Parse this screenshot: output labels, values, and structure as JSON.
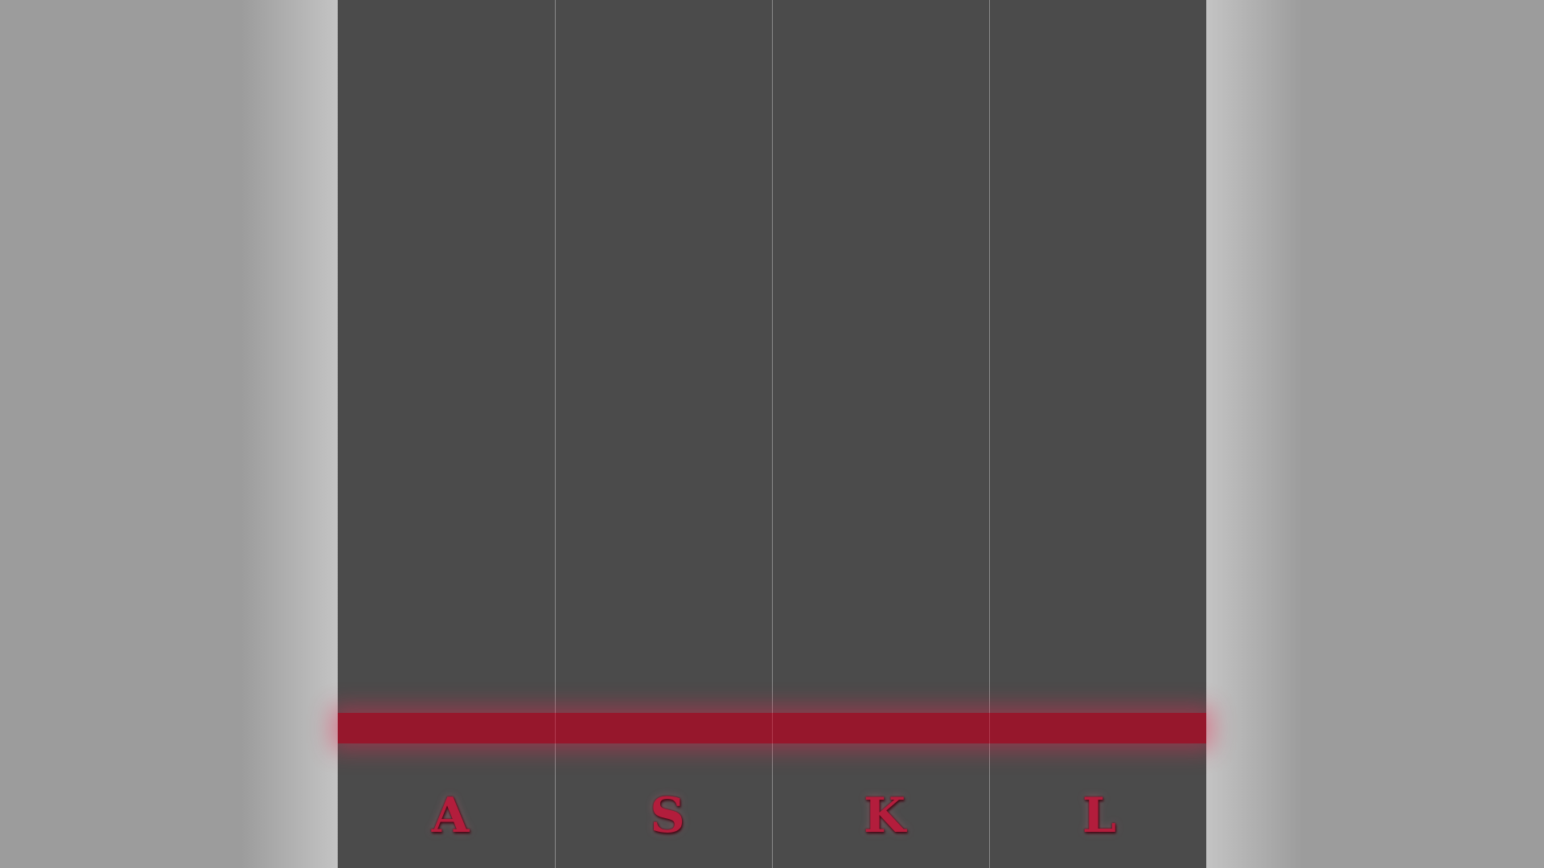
{
  "game": {
    "lanes": [
      {
        "key": "A"
      },
      {
        "key": "S"
      },
      {
        "key": "K"
      },
      {
        "key": "L"
      }
    ],
    "colors": {
      "background": "#9c9c9c",
      "playfield": "#4b4b4b",
      "hit_line": "#96172c",
      "key_label": "#b31d3c",
      "lane_divider": "#8a8a8a"
    }
  }
}
